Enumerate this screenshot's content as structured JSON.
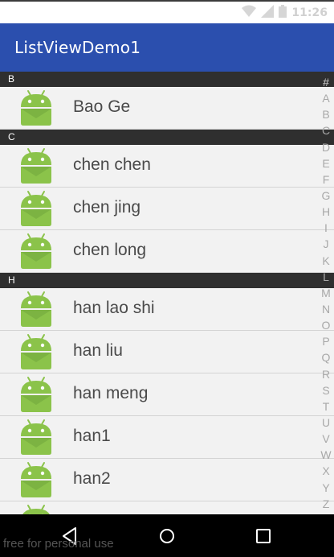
{
  "status_bar": {
    "time": "11:26",
    "icons": [
      "wifi-icon",
      "signal-icon",
      "battery-icon"
    ]
  },
  "app_bar": {
    "title": "ListViewDemo1",
    "color": "#2b4fae"
  },
  "list": {
    "groups": [
      {
        "letter": "B",
        "items": [
          "Bao Ge"
        ]
      },
      {
        "letter": "C",
        "items": [
          "chen chen",
          "chen jing",
          "chen long"
        ]
      },
      {
        "letter": "H",
        "items": [
          "han lao shi",
          "han liu",
          "han meng",
          "han1",
          "han2",
          ""
        ]
      }
    ],
    "avatar_icon": "android-icon"
  },
  "index_bar": [
    "#",
    "A",
    "B",
    "C",
    "D",
    "E",
    "F",
    "G",
    "H",
    "I",
    "J",
    "K",
    "L",
    "M",
    "N",
    "O",
    "P",
    "Q",
    "R",
    "S",
    "T",
    "U",
    "V",
    "W",
    "X",
    "Y",
    "Z"
  ],
  "nav_bar": {
    "buttons": [
      "back-icon",
      "home-icon",
      "recents-icon"
    ],
    "watermark": "free for personal use"
  }
}
